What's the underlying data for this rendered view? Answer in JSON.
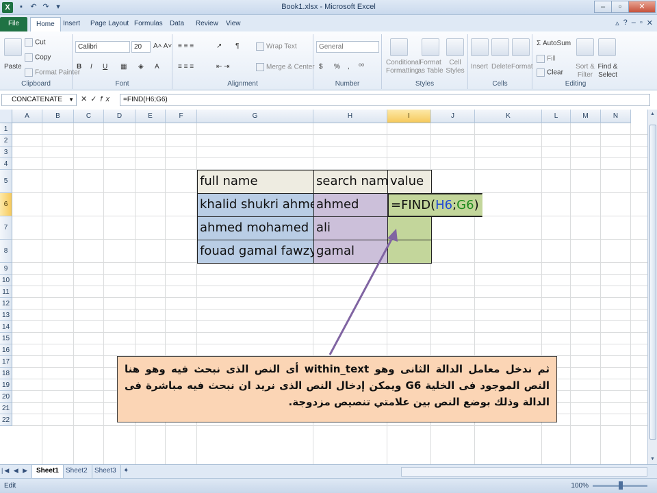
{
  "window": {
    "title": "Book1.xlsx - Microsoft Excel",
    "app_icon": "X"
  },
  "ribbon_tabs": [
    {
      "label": "File"
    },
    {
      "label": "Home"
    },
    {
      "label": "Insert"
    },
    {
      "label": "Page Layout"
    },
    {
      "label": "Formulas"
    },
    {
      "label": "Data"
    },
    {
      "label": "Review"
    },
    {
      "label": "View"
    }
  ],
  "ribbon": {
    "clipboard": {
      "paste": "Paste",
      "cut": "Cut",
      "copy": "Copy",
      "format_painter": "Format Painter",
      "label": "Clipboard"
    },
    "font": {
      "name": "Calibri",
      "size": "20",
      "label": "Font",
      "bold": "B",
      "italic": "I",
      "underline": "U"
    },
    "alignment": {
      "wrap_text": "Wrap Text",
      "merge_center": "Merge & Center",
      "label": "Alignment"
    },
    "number": {
      "format": "General",
      "currency": "$",
      "percent": "%",
      "comma": ",",
      "label": "Number"
    },
    "styles": {
      "conditional": "Conditional Formatting",
      "format_table": "Format as Table",
      "cell_styles": "Cell Styles",
      "label": "Styles"
    },
    "cells": {
      "insert": "Insert",
      "delete": "Delete",
      "format": "Format",
      "label": "Cells"
    },
    "editing": {
      "autosum": "AutoSum",
      "fill": "Fill",
      "clear": "Clear",
      "sort_filter": "Sort & Filter",
      "find_select": "Find & Select",
      "label": "Editing"
    }
  },
  "formula_bar": {
    "name_box": "CONCATENATE",
    "cancel": "✕",
    "enter": "✓",
    "fx": "fx",
    "formula": "=FIND(H6;G6)"
  },
  "columns": [
    "A",
    "B",
    "C",
    "D",
    "E",
    "F",
    "G",
    "H",
    "I",
    "J",
    "K",
    "L",
    "M",
    "N"
  ],
  "rows": [
    "1",
    "2",
    "3",
    "4",
    "5",
    "6",
    "7",
    "8",
    "9",
    "10",
    "11",
    "12",
    "13",
    "14",
    "15",
    "16",
    "17",
    "18",
    "19",
    "20",
    "21",
    "22"
  ],
  "table": {
    "headers": [
      "full name",
      "search name",
      "value"
    ],
    "rows": [
      {
        "full_name": "khalid shukri ahmed",
        "search_name": "ahmed",
        "value_prefix": "=FIND(",
        "ref1": "H6",
        "sep": ";",
        "ref2": "G6",
        "close": ")"
      },
      {
        "full_name": "ahmed mohamed ali",
        "search_name": "ali",
        "value": ""
      },
      {
        "full_name": "fouad gamal fawzy",
        "search_name": "gamal",
        "value": ""
      }
    ]
  },
  "callout": {
    "text": "ثم ندخل معامل الدالة الثانى وهو within_text أى النص الذى نبحث فيه وهو هنا النص الموجود فى الخلية G6 ويمكن إدخال النص الذى نريد ان نبحث فيه مباشرة فى الدالة وذلك بوضع النص بين علامتي تنصيص مزدوجة."
  },
  "sheets": [
    "Sheet1",
    "Sheet2",
    "Sheet3"
  ],
  "status": {
    "mode": "Edit",
    "zoom": "100%"
  },
  "colors": {
    "accent": "#1f7244",
    "callout_fill": "#fbd5b5",
    "arrow": "#8064a2"
  }
}
